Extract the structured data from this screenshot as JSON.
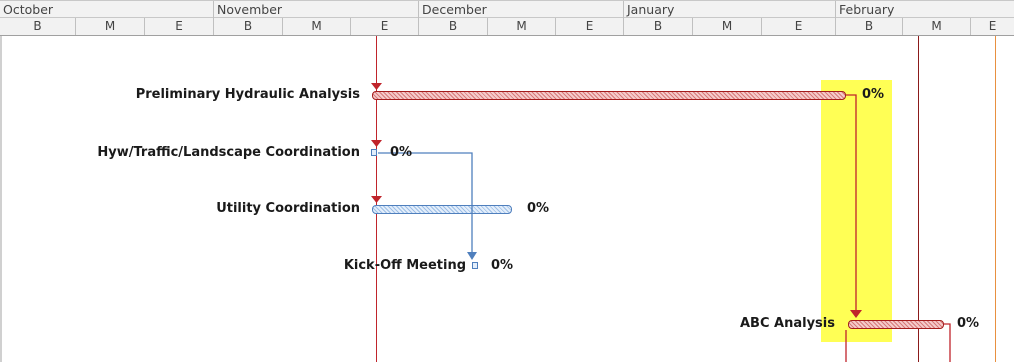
{
  "timescale": {
    "months": [
      "October",
      "November",
      "December",
      "January",
      "February"
    ],
    "sub_periods": [
      "B",
      "M",
      "E",
      "B",
      "M",
      "E",
      "B",
      "M",
      "E",
      "B",
      "M",
      "E",
      "B",
      "M",
      "E"
    ]
  },
  "tasks": [
    {
      "name": "Preliminary Hydraulic Analysis",
      "complete": "0%"
    },
    {
      "name": "Hyw/Traffic/Landscape Coordination",
      "complete": "0%"
    },
    {
      "name": "Utility Coordination",
      "complete": "0%"
    },
    {
      "name": "Kick-Off Meeting",
      "complete": "0%"
    },
    {
      "name": "ABC Analysis",
      "complete": "0%"
    }
  ],
  "colors": {
    "critical_link": "#c0242b",
    "noncritical_link": "#4f7fbd",
    "status_date_line": "#d45a1a",
    "highlight": "#ffff55"
  }
}
